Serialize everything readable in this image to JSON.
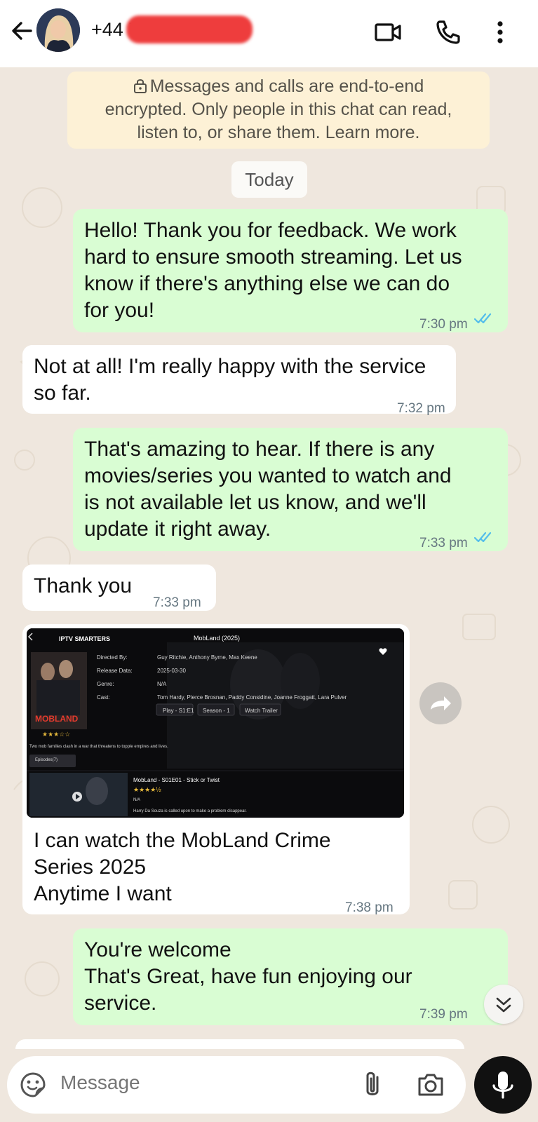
{
  "header": {
    "contact_visible": "+44 7",
    "icons": [
      "back-arrow-icon",
      "avatar",
      "video-call-icon",
      "phone-icon",
      "more-vertical-icon"
    ]
  },
  "notice": {
    "line1": "Messages and calls are end-to-end",
    "line2": "encrypted. Only people in this chat can read,",
    "line3": "listen to, or share them. Learn more."
  },
  "day_chip": "Today",
  "messages": [
    {
      "dir": "out",
      "lines": [
        "Hello! Thank you for feedback. We work",
        "hard to ensure smooth streaming. Let us",
        "know if there's anything else we can do",
        "for you!"
      ],
      "time": "7:30 pm",
      "read": true
    },
    {
      "dir": "in",
      "lines": [
        "Not at all! I'm really happy with the service",
        "so far."
      ],
      "time": "7:32 pm"
    },
    {
      "dir": "out",
      "lines": [
        "That's amazing to hear. If there is any",
        "movies/series you wanted to watch and",
        "is not available let us know, and we'll",
        "update it right away."
      ],
      "time": "7:33 pm",
      "read": true
    },
    {
      "dir": "in",
      "lines": [
        "Thank you"
      ],
      "time": "7:33 pm"
    },
    {
      "dir": "in",
      "type": "image",
      "lines": [
        "I can watch the MobLand Crime",
        "Series 2025",
        "Anytime I want"
      ],
      "time": "7:38 pm"
    },
    {
      "dir": "out",
      "lines": [
        "You're welcome",
        "That's Great, have fun enjoying our",
        "service."
      ],
      "time": "7:39 pm"
    }
  ],
  "screenshot": {
    "app_brand": "IPTV SMARTERS",
    "title": "MobLand (2025)",
    "labels": [
      "Directed By:",
      "Release Data:",
      "Genre:",
      "Cast:"
    ],
    "values": [
      "Guy Ritchie, Anthony Byrne, Max Keene",
      "2025-03-30",
      "N/A",
      "Tom Hardy, Pierce Brosnan, Paddy Considine, Joanne Froggatt, Lara Pulver"
    ],
    "buttons": [
      "Play - S1:E1",
      "Season - 1",
      "Watch Trailer"
    ],
    "poster_title": "MOBLAND",
    "synopsis": "Two mob families clash in a war that threatens to topple empires and lives.",
    "episodes_button": "Episodes(7)",
    "episode_title": "MobLand - S01E01 - Stick or Twist",
    "episode_genre": "N/A",
    "episode_desc": "Harry Da Souza is called upon to make a problem disappear.",
    "poster_rating": 3.5,
    "episode_rating": 4.5
  },
  "composer": {
    "placeholder": "Message",
    "icons": [
      "emoji-sticker-icon",
      "attach-icon",
      "camera-icon",
      "mic-icon"
    ]
  },
  "colors": {
    "outgoing": "#d9fdd3",
    "incoming": "#ffffff",
    "background": "#efe7de",
    "notice": "#fdf1d6",
    "read_ticks": "#53bdeb"
  }
}
